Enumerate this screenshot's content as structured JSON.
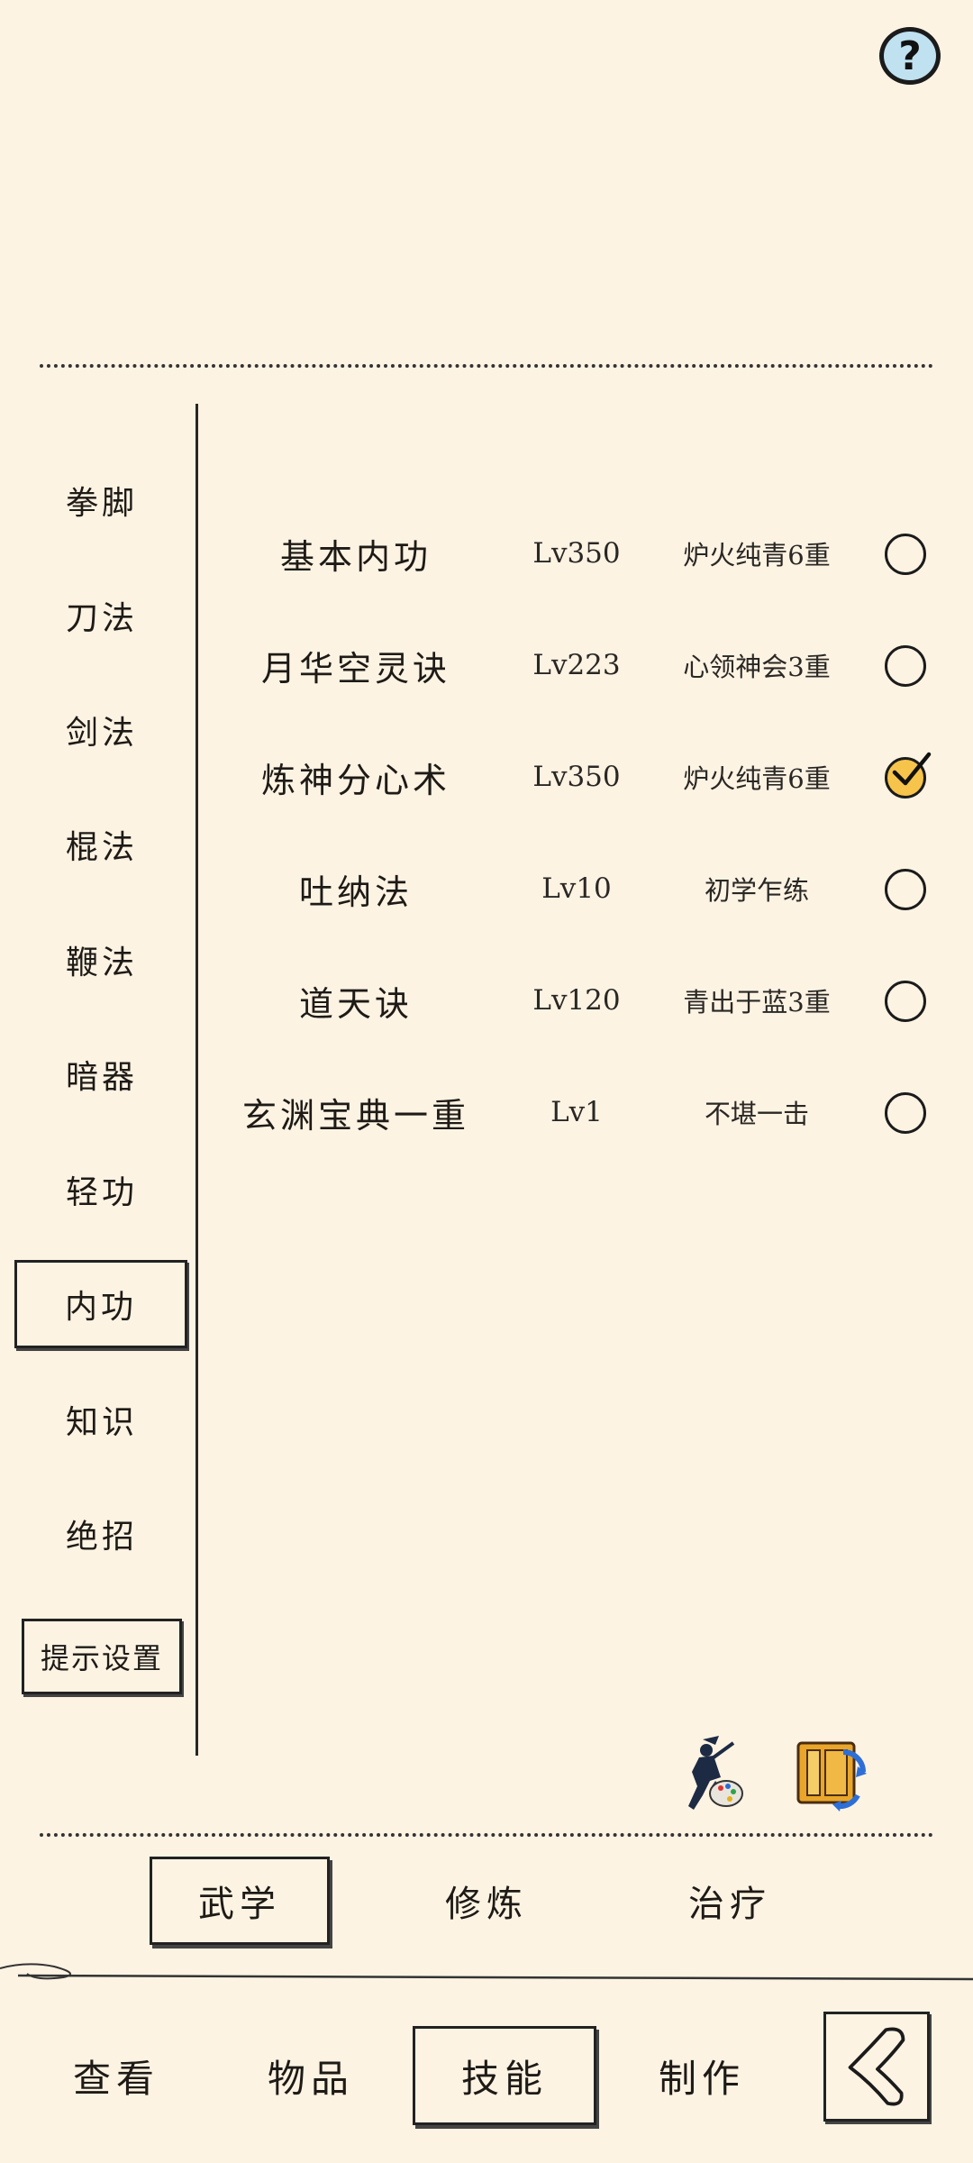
{
  "help": {
    "glyph": "?"
  },
  "sidebar": {
    "items": [
      {
        "label": "拳脚"
      },
      {
        "label": "刀法"
      },
      {
        "label": "剑法"
      },
      {
        "label": "棍法"
      },
      {
        "label": "鞭法"
      },
      {
        "label": "暗器"
      },
      {
        "label": "轻功"
      },
      {
        "label": "内功",
        "active": true
      },
      {
        "label": "知识"
      },
      {
        "label": "绝招"
      }
    ],
    "hint_setting": "提示设置"
  },
  "skills": [
    {
      "name": "基本内功",
      "level": "Lv350",
      "rank": "炉火纯青6重",
      "checked": false
    },
    {
      "name": "月华空灵诀",
      "level": "Lv223",
      "rank": "心领神会3重",
      "checked": false
    },
    {
      "name": "炼神分心术",
      "level": "Lv350",
      "rank": "炉火纯青6重",
      "checked": true
    },
    {
      "name": "吐纳法",
      "level": "Lv10",
      "rank": "初学乍练",
      "checked": false
    },
    {
      "name": "道天诀",
      "level": "Lv120",
      "rank": "青出于蓝3重",
      "checked": false
    },
    {
      "name": "玄渊宝典一重",
      "level": "Lv1",
      "rank": "不堪一击",
      "checked": false
    }
  ],
  "tools": [
    {
      "icon": "martial-artist-palette-icon"
    },
    {
      "icon": "book-refresh-icon"
    }
  ],
  "category_tabs": [
    {
      "label": "武学",
      "active": true
    },
    {
      "label": "修炼"
    },
    {
      "label": "治疗"
    }
  ],
  "bottom_nav": [
    {
      "label": "查看"
    },
    {
      "label": "物品"
    },
    {
      "label": "技能",
      "active": true
    },
    {
      "label": "制作"
    }
  ],
  "back": {
    "icon": "back-arrow-icon"
  },
  "colors": {
    "background": "#fcf3e3",
    "ink": "#1e1a16",
    "checked_fill": "#f6c44a",
    "help_fill": "#bfe1f0"
  }
}
